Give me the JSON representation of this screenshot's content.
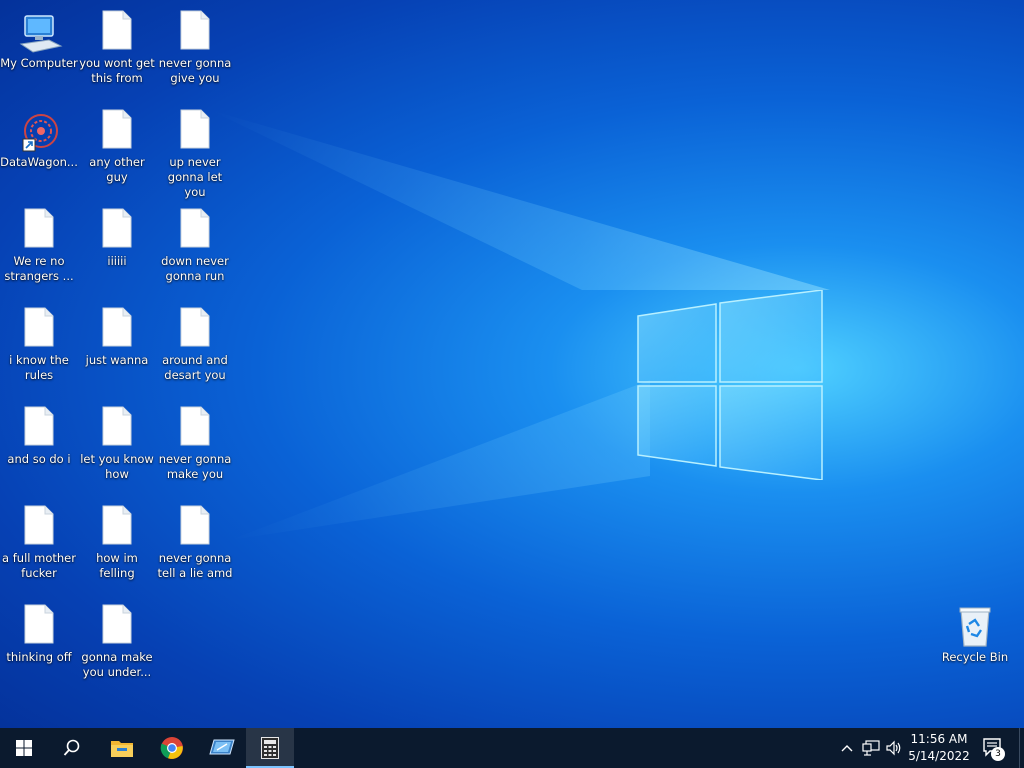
{
  "desktop": {
    "icons": [
      {
        "label": "My Computer",
        "type": "computer-icon"
      },
      {
        "label": "DataWagon...",
        "type": "app-shortcut-icon"
      },
      {
        "label": "We re no strangers ...",
        "type": "file-icon"
      },
      {
        "label": "i know the rules",
        "type": "file-icon"
      },
      {
        "label": "and so do i",
        "type": "file-icon"
      },
      {
        "label": "a full mother fucker",
        "type": "file-icon"
      },
      {
        "label": "thinking off",
        "type": "file-icon"
      },
      {
        "label": "you wont get this from",
        "type": "file-icon"
      },
      {
        "label": "any other guy",
        "type": "file-icon"
      },
      {
        "label": "iiiiii",
        "type": "file-icon"
      },
      {
        "label": "just wanna",
        "type": "file-icon"
      },
      {
        "label": "let you know how",
        "type": "file-icon"
      },
      {
        "label": "how im felling",
        "type": "file-icon"
      },
      {
        "label": "gonna make you under...",
        "type": "file-icon"
      },
      {
        "label": "never gonna give you",
        "type": "file-icon"
      },
      {
        "label": "up never gonna let you",
        "type": "file-icon"
      },
      {
        "label": "down never gonna run",
        "type": "file-icon"
      },
      {
        "label": "around and desart you",
        "type": "file-icon"
      },
      {
        "label": "never gonna make you",
        "type": "file-icon"
      },
      {
        "label": "never gonna tell a lie amd",
        "type": "file-icon"
      }
    ],
    "recycle_bin": {
      "label": "Recycle Bin"
    }
  },
  "taskbar": {
    "pinned": [
      "start-icon",
      "search-icon",
      "file-explorer-icon",
      "chrome-icon",
      "remote-app-icon",
      "calculator-icon"
    ],
    "active": "calculator-icon",
    "clock": {
      "time": "11:56 AM",
      "date": "5/14/2022"
    },
    "notification_count": "3"
  },
  "colors": {
    "taskbar_bg": "#0b1a2e",
    "accent": "#7cc4ff"
  }
}
